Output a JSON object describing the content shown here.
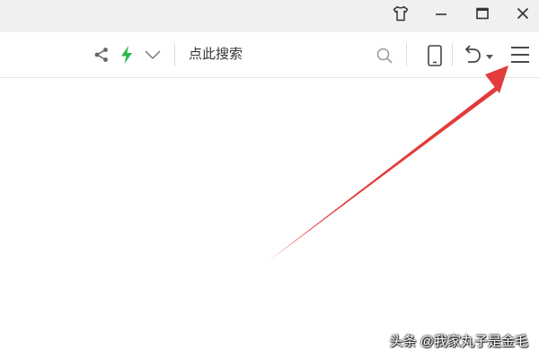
{
  "titlebar": {
    "buttons": [
      {
        "name": "skin",
        "icon": "shirt-icon"
      },
      {
        "name": "minimize",
        "icon": "minimize-icon"
      },
      {
        "name": "maximize",
        "icon": "maximize-icon"
      },
      {
        "name": "close",
        "icon": "close-icon"
      }
    ]
  },
  "toolbar": {
    "share_icon": "share-icon",
    "bolt_icon": "lightning-bolt-icon",
    "bolt_color": "#2db84d",
    "dropdown_icon": "chevron-down-icon",
    "search": {
      "text": "点此搜索",
      "icon": "search-icon"
    },
    "mobile_icon": "mobile-phone-icon",
    "undo_icon": "undo-icon",
    "menu_icon": "hamburger-menu-icon"
  },
  "annotation": {
    "arrow_color": "#e23b3b",
    "points_to": "hamburger-menu-icon"
  },
  "watermark": {
    "text": "头条 @我家丸子是金毛"
  }
}
